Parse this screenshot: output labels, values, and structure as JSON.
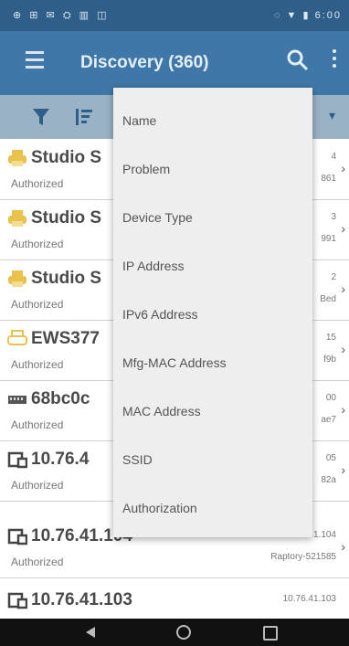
{
  "status_bar": {
    "left_icons": "⊕ ⊞ ✉ ⛭ ▥ ◫",
    "right_text": "◌ ▼ ▮ 6:00"
  },
  "app_bar": {
    "title": "Discovery (360)"
  },
  "columns_menu": {
    "items": [
      "Name",
      "Problem",
      "Device Type",
      "IP Address",
      "IPv6 Address",
      "Mfg-MAC Address",
      "MAC Address",
      "SSID",
      "Authorization"
    ]
  },
  "devices": [
    {
      "icon": "printer-yellow-icon",
      "name": "Studio S",
      "sub": "Authorized",
      "ip": "4",
      "id": "861"
    },
    {
      "icon": "printer-yellow-icon",
      "name": "Studio S",
      "sub": "Authorized",
      "ip": "3",
      "id": "991"
    },
    {
      "icon": "printer-yellow-icon",
      "name": "Studio S",
      "sub": "Authorized",
      "ip": "2",
      "id": "Bed"
    },
    {
      "icon": "printer-outline-icon",
      "name": "EWS377",
      "sub": "Authorized",
      "ip": "15",
      "id": "f9b"
    },
    {
      "icon": "switch-icon",
      "name": "68bc0c",
      "sub": "Authorized",
      "ip": "00",
      "id": "ae7"
    },
    {
      "icon": "device-icon",
      "name": "10.76.4",
      "sub": "Authorized",
      "ip": "05",
      "id": "82a"
    },
    {
      "icon": "device-icon",
      "name": "10.76.41.104",
      "sub": "Authorized",
      "ip": "10.76.41.104",
      "id": "Raptory-521585"
    },
    {
      "icon": "device-icon",
      "name": "10.76.41.103",
      "sub": "",
      "ip": "10.76.41.103",
      "id": ""
    }
  ],
  "colors": {
    "status_bar": "#2f5f88",
    "app_bar": "#3f78a8",
    "toolbar": "#9ab2c5",
    "printer": "#e8c24a"
  }
}
